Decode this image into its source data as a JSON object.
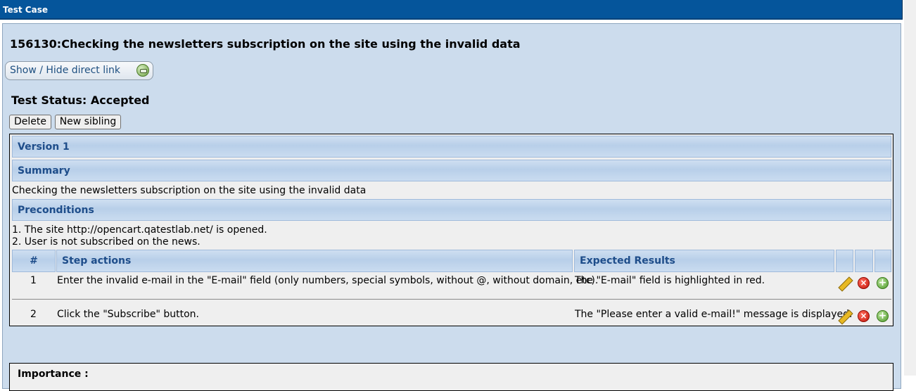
{
  "window": {
    "title": "Test Case"
  },
  "testcase": {
    "title": "156130:Checking the newsletters subscription on the site using the invalid data",
    "direct_link_label": "Show / Hide direct link",
    "status": "Test Status: Accepted",
    "buttons": {
      "delete": "Delete",
      "new_sibling": "New sibling"
    }
  },
  "version": {
    "label": "Version 1",
    "summary_header": "Summary",
    "summary_text": "Checking the newsletters subscription on the site using the invalid data",
    "preconditions_header": "Preconditions",
    "preconditions": [
      "1. The site http://opencart.qatestlab.net/ is opened.",
      "2. User is not subscribed on the news."
    ],
    "steps_table": {
      "headers": {
        "num": "#",
        "actions": "Step actions",
        "expected": "Expected Results"
      },
      "rows": [
        {
          "num": "1",
          "action": "Enter the invalid e-mail in the \"E-mail\" field (only numbers, special symbols, without @, without domain, etc).",
          "expected": "The \"E-mail\" field is highlighted in red."
        },
        {
          "num": "2",
          "action": "Click the \"Subscribe\" button.",
          "expected": "The \"Please enter a valid e-mail!\" message is displayed."
        }
      ],
      "row_icons": [
        "pencil-icon",
        "delete-icon",
        "add-icon"
      ]
    }
  },
  "importance": {
    "label": "Importance :"
  },
  "colors": {
    "titlebar": "#05559b",
    "panel_bg": "#ccdced",
    "section_header_text": "#1e4d8a",
    "content_bg": "#efefef"
  }
}
